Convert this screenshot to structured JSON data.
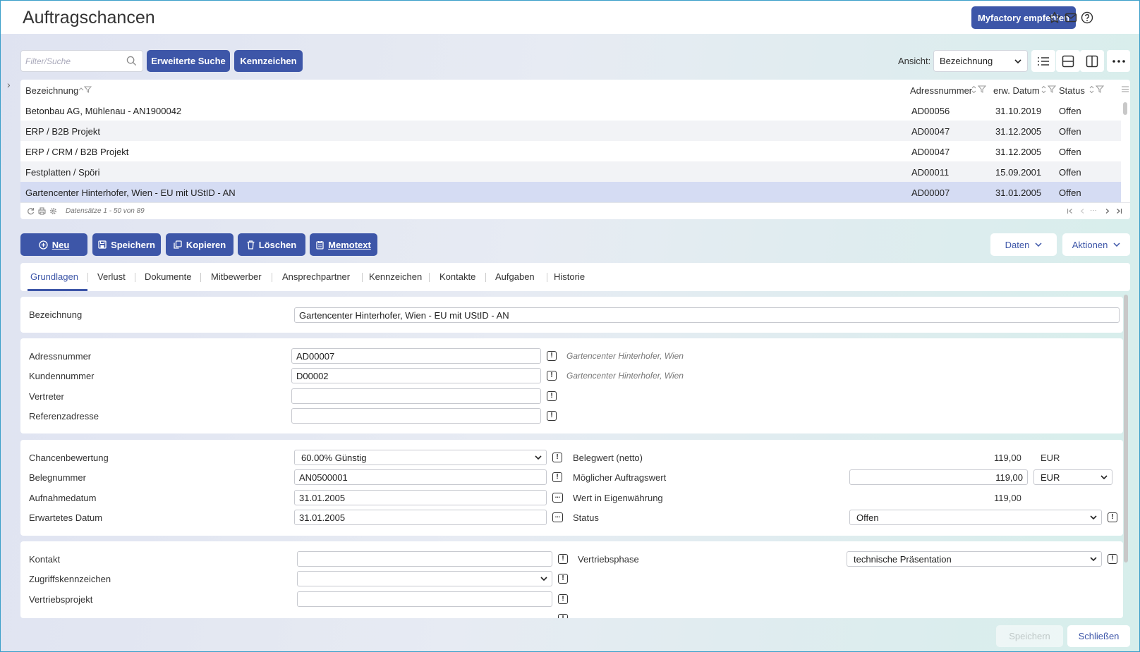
{
  "app": {
    "title": "Auftragschancen",
    "recommend": "Myfactory empfehlen"
  },
  "toolbar": {
    "filter_placeholder": "Filter/Suche",
    "advanced_search": "Erweiterte Suche",
    "flags": "Kennzeichen",
    "view_label": "Ansicht:",
    "view_value": "Bezeichnung"
  },
  "grid": {
    "columns": [
      "Bezeichnung",
      "Adressnummer",
      "erw. Datum",
      "Status"
    ],
    "rows": [
      [
        "Betonbau AG, Mühlenau - AN1900042",
        "AD00056",
        "31.10.2019",
        "Offen"
      ],
      [
        "ERP / B2B Projekt",
        "AD00047",
        "31.12.2005",
        "Offen"
      ],
      [
        "ERP / CRM / B2B Projekt",
        "AD00047",
        "31.12.2005",
        "Offen"
      ],
      [
        "Festplatten / Spöri",
        "AD00011",
        "15.09.2001",
        "Offen"
      ],
      [
        "Gartencenter Hinterhofer, Wien - EU mit UStID - AN",
        "AD00007",
        "31.01.2005",
        "Offen"
      ]
    ],
    "footer": "Datensätze 1 - 50 von 89",
    "pager_dots": "···"
  },
  "actions": {
    "new": "Neu",
    "save": "Speichern",
    "copy": "Kopieren",
    "delete": "Löschen",
    "memo": "Memotext",
    "data": "Daten",
    "actions": "Aktionen"
  },
  "tabs": [
    "Grundlagen",
    "Verlust",
    "Dokumente",
    "Mitbewerber",
    "Ansprechpartner",
    "Kennzeichen",
    "Kontakte",
    "Aufgaben",
    "Historie"
  ],
  "form": {
    "bezeichnung_label": "Bezeichnung",
    "bezeichnung_value": "Gartencenter Hinterhofer, Wien - EU mit UStID - AN",
    "adressnummer_label": "Adressnummer",
    "adressnummer_value": "AD00007",
    "adressnummer_hint": "Gartencenter Hinterhofer, Wien",
    "kundennummer_label": "Kundennummer",
    "kundennummer_value": "D00002",
    "kundennummer_hint": "Gartencenter Hinterhofer, Wien",
    "vertreter_label": "Vertreter",
    "referenz_label": "Referenzadresse",
    "chancen_label": "Chancenbewertung",
    "chancen_value": "60.00% Günstig",
    "belegnummer_label": "Belegnummer",
    "belegnummer_value": "AN0500001",
    "aufnahme_label": "Aufnahmedatum",
    "aufnahme_value": "31.01.2005",
    "erwartet_label": "Erwartetes Datum",
    "erwartet_value": "31.01.2005",
    "belegwert_label": "Belegwert (netto)",
    "belegwert_value": "119,00",
    "belegwert_currency": "EUR",
    "moeglich_label": "Möglicher Auftragswert",
    "moeglich_value": "119,00",
    "moeglich_currency": "EUR",
    "eigen_label": "Wert in Eigenwährung",
    "eigen_value": "119,00",
    "status_label": "Status",
    "status_value": "Offen",
    "kontakt_label": "Kontakt",
    "zugriff_label": "Zugriffskennzeichen",
    "vertriebsprojekt_label": "Vertriebsprojekt",
    "vertriebsphase_label": "Vertriebsphase",
    "vertriebsphase_value": "technische Präsentation"
  },
  "footer": {
    "save": "Speichern",
    "close": "Schließen"
  }
}
